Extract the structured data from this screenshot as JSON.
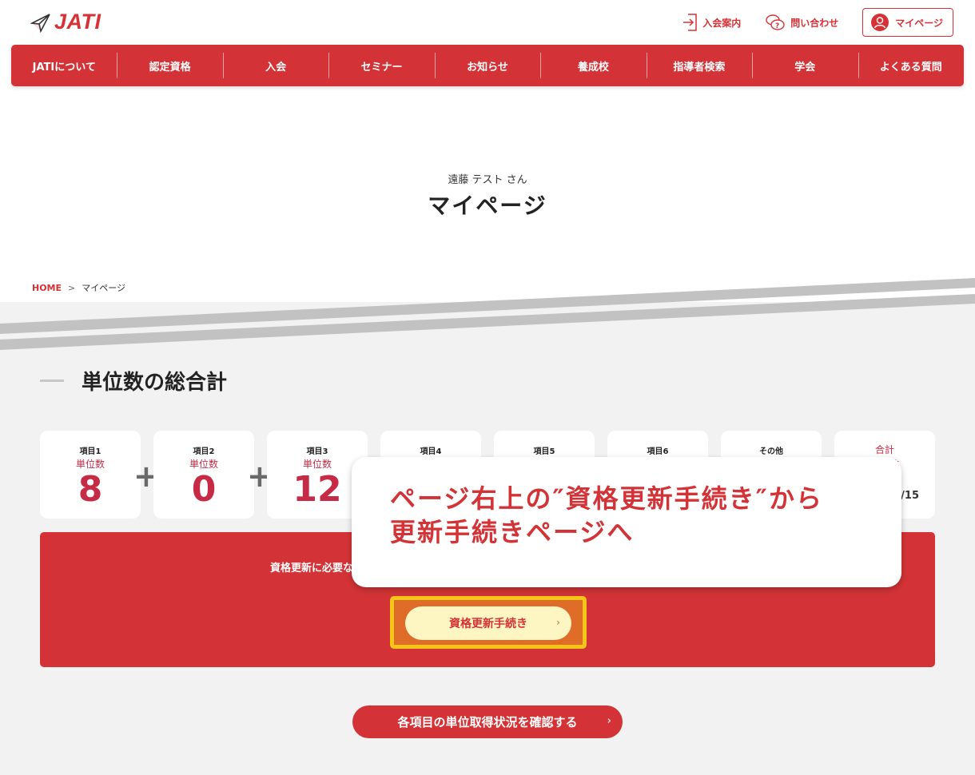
{
  "header": {
    "logo_text": "JATI",
    "utility": {
      "admission_guide": "入会案内",
      "contact": "問い合わせ",
      "mypage": "マイページ"
    }
  },
  "nav": {
    "items": [
      "JATIについて",
      "認定資格",
      "入会",
      "セミナー",
      "お知らせ",
      "養成校",
      "指導者検索",
      "学会",
      "よくある質問"
    ]
  },
  "page": {
    "user_name": "遠藤 テスト さん",
    "title": "マイページ"
  },
  "breadcrumb": {
    "home": "HOME",
    "separator": ">",
    "current": "マイページ"
  },
  "credits": {
    "section_title": "単位数の総合計",
    "unit_label": "単位数",
    "cards": [
      {
        "label": "項目1",
        "value": "8"
      },
      {
        "label": "項目2",
        "value": "0"
      },
      {
        "label": "項目3",
        "value": "12"
      },
      {
        "label": "項目4",
        "value": ""
      },
      {
        "label": "項目5",
        "value": ""
      },
      {
        "label": "項目6",
        "value": ""
      },
      {
        "label": "その他",
        "value": ""
      }
    ],
    "plus_sign": "+",
    "total": {
      "label": "合計",
      "unit_label": "単位数",
      "max_suffix": "/15"
    }
  },
  "renewal": {
    "notice_text": "資格更新に必要な",
    "button_label": "資格更新手続き",
    "arrow": "›"
  },
  "tooltip": {
    "line1": "ページ右上の″資格更新手続き″から",
    "line2": "更新手続きページへ"
  },
  "status_button": {
    "label": "各項目の単位取得状況を確認する",
    "arrow": "›"
  },
  "colors": {
    "brand_red": "#d33336",
    "value_red": "#c72a44",
    "highlight_yellow": "#f5c518",
    "renew_button_bg": "#fef6c2"
  }
}
